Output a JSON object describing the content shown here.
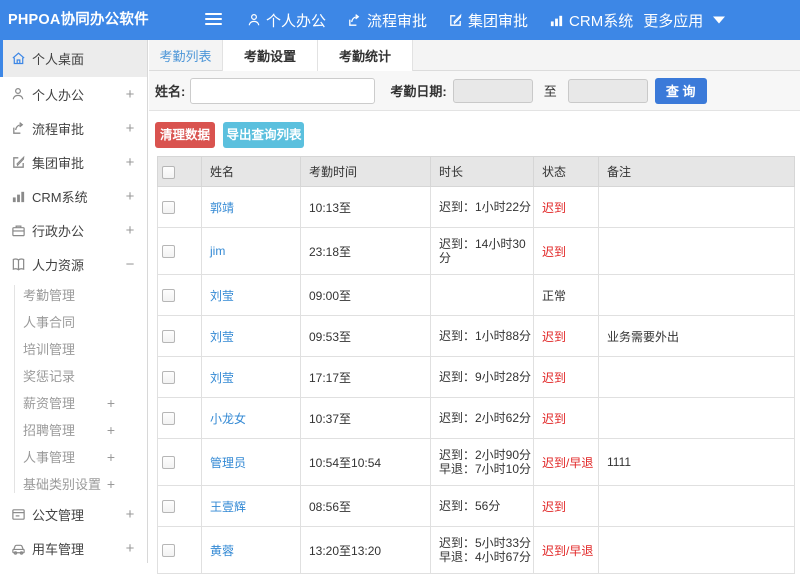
{
  "topbar": {
    "title": "PHPOA协同办公软件",
    "nav": [
      {
        "label": "个人办公",
        "icon": "user-icon"
      },
      {
        "label": "流程审批",
        "icon": "flow-icon"
      },
      {
        "label": "集团审批",
        "icon": "edit-icon"
      },
      {
        "label": "CRM系统",
        "icon": "chart-icon"
      },
      {
        "label": "更多应用",
        "icon": "caret-down-icon"
      }
    ]
  },
  "sidebar": {
    "items": [
      {
        "label": "个人桌面",
        "icon": "home-icon",
        "selected": true,
        "expand": ""
      },
      {
        "label": "个人办公",
        "icon": "user-icon",
        "expand": "+"
      },
      {
        "label": "流程审批",
        "icon": "flow-icon",
        "expand": "+"
      },
      {
        "label": "集团审批",
        "icon": "edit-icon",
        "expand": "+"
      },
      {
        "label": "CRM系统",
        "icon": "chart-icon",
        "expand": "+"
      },
      {
        "label": "行政办公",
        "icon": "briefcase-icon",
        "expand": "+"
      },
      {
        "label": "人力资源",
        "icon": "book-icon",
        "expand": "−",
        "expanded": true,
        "children": [
          {
            "label": "考勤管理",
            "expand": ""
          },
          {
            "label": "人事合同",
            "expand": ""
          },
          {
            "label": "培训管理",
            "expand": ""
          },
          {
            "label": "奖惩记录",
            "expand": ""
          },
          {
            "label": "薪资管理",
            "expand": "+"
          },
          {
            "label": "招聘管理",
            "expand": "+"
          },
          {
            "label": "人事管理",
            "expand": "+"
          },
          {
            "label": "基础类别设置",
            "expand": "+"
          }
        ]
      },
      {
        "label": "公文管理",
        "icon": "doc-icon",
        "expand": "+"
      },
      {
        "label": "用车管理",
        "icon": "car-icon",
        "expand": "+"
      }
    ]
  },
  "tabs": [
    {
      "label": "考勤列表",
      "active": true
    },
    {
      "label": "考勤设置",
      "active": false
    },
    {
      "label": "考勤统计",
      "active": false
    }
  ],
  "filter": {
    "name_label": "姓名:",
    "name_value": "",
    "date_label": "考勤日期:",
    "date_from": "",
    "to_label": "至",
    "date_to": "",
    "search_button": "查 询"
  },
  "actions": {
    "clear_button": "清理数据",
    "export_button": "导出查询列表"
  },
  "table": {
    "headers": [
      "姓名",
      "考勤时间",
      "时长",
      "状态",
      "备注"
    ],
    "rows": [
      {
        "name": "郭靖",
        "time": "10:13至",
        "duration": [
          "迟到：1小时22分"
        ],
        "status": "迟到",
        "status_color": "red",
        "note": ""
      },
      {
        "name": "jim",
        "time": "23:18至",
        "duration": [
          "迟到：14小时30",
          "分"
        ],
        "status": "迟到",
        "status_color": "red",
        "note": ""
      },
      {
        "name": "刘莹",
        "time": "09:00至",
        "duration": [],
        "status": "正常",
        "status_color": "normal",
        "note": ""
      },
      {
        "name": "刘莹",
        "time": "09:53至",
        "duration": [
          "迟到：1小时88分"
        ],
        "status": "迟到",
        "status_color": "red",
        "note": "业务需要外出"
      },
      {
        "name": "刘莹",
        "time": "17:17至",
        "duration": [
          "迟到：9小时28分"
        ],
        "status": "迟到",
        "status_color": "red",
        "note": ""
      },
      {
        "name": "小龙女",
        "time": "10:37至",
        "duration": [
          "迟到：2小时62分"
        ],
        "status": "迟到",
        "status_color": "red",
        "note": ""
      },
      {
        "name": "管理员",
        "time": "10:54至10:54",
        "duration": [
          "迟到：2小时90分",
          "早退：7小时10分"
        ],
        "status": "迟到/早退",
        "status_color": "red",
        "note": "1111"
      },
      {
        "name": "王壹辉",
        "time": "08:56至",
        "duration": [
          "迟到：56分"
        ],
        "status": "迟到",
        "status_color": "red",
        "note": ""
      },
      {
        "name": "黄蓉",
        "time": "13:20至13:20",
        "duration": [
          "迟到：5小时33分",
          "早退：4小时67分"
        ],
        "status": "迟到/早退",
        "status_color": "red",
        "note": ""
      }
    ]
  },
  "colors": {
    "topbar_blue": "#3d87e6",
    "search_blue": "#3b7ad9",
    "danger_red": "#d9534f",
    "info_cyan": "#5bc0de",
    "link_blue": "#3389d4",
    "status_red": "#e12626",
    "active_tab_blue": "#4f97d8"
  }
}
